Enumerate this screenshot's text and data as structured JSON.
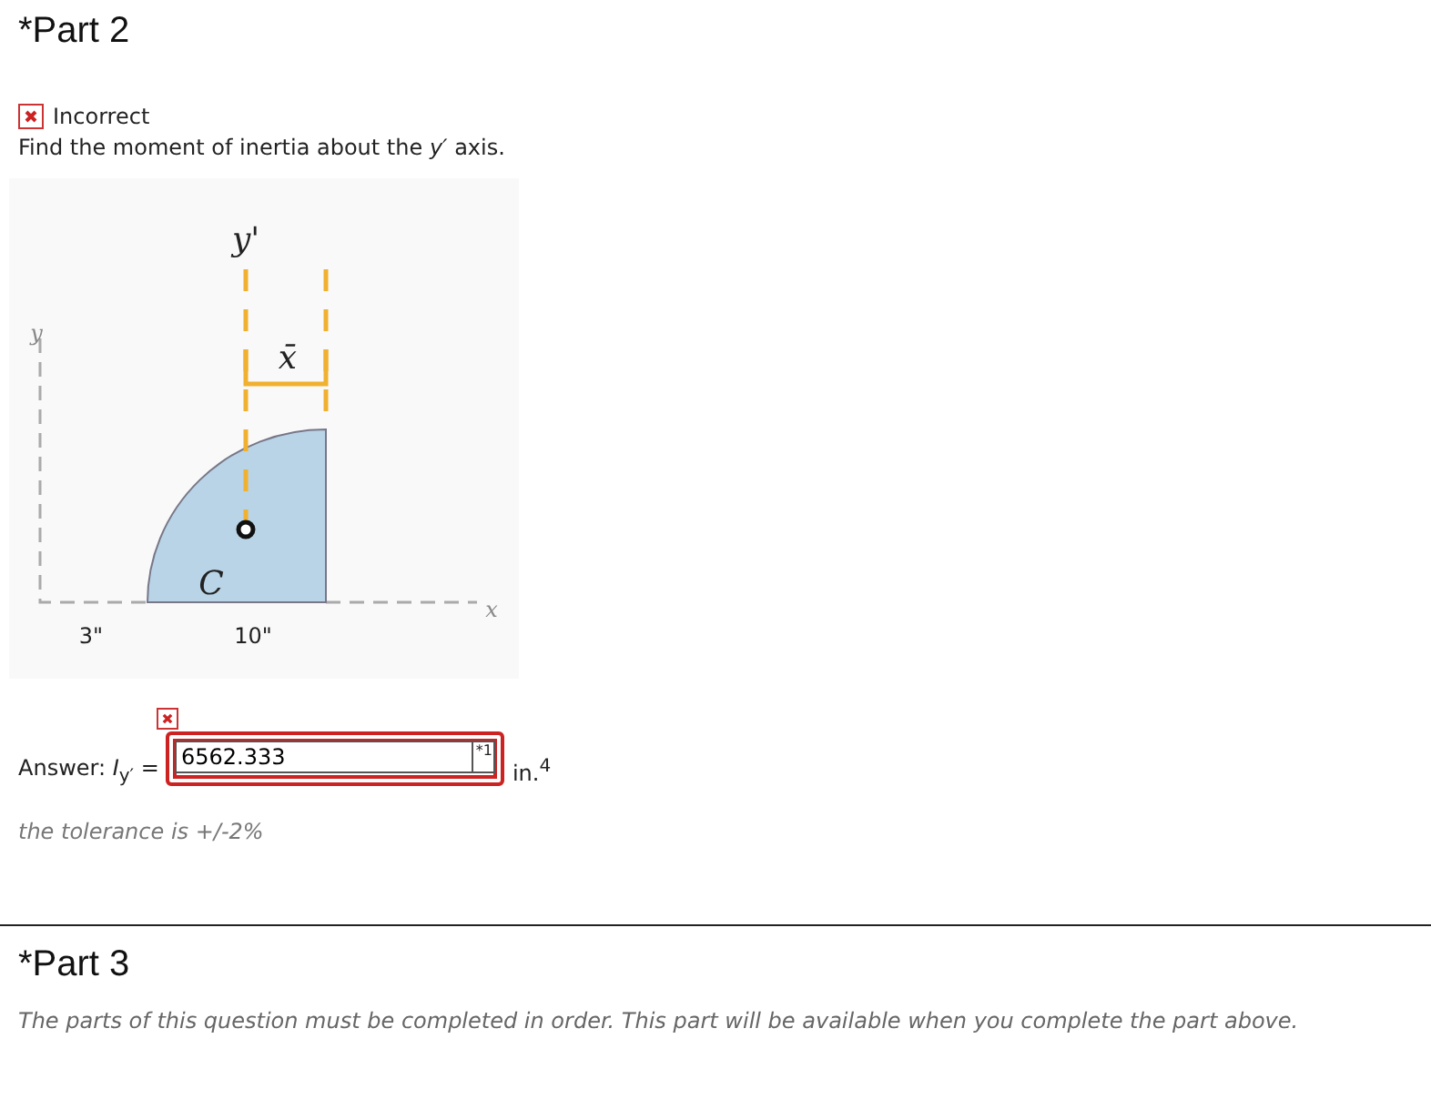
{
  "part2": {
    "title": "*Part 2",
    "status": {
      "kind": "incorrect",
      "label": "Incorrect"
    },
    "question": "Find the moment of inertia about the *y′* axis.",
    "figure": {
      "labels": [
        "y'",
        "x̄",
        "y",
        "C",
        "x",
        "3\"",
        "10\""
      ]
    },
    "answer": {
      "label": "Answer: *I*$_{y′}$ =",
      "value": "6562.333",
      "marker": "*1",
      "unit": "in.$^{4}$",
      "incorrect": true,
      "tolerance": "the tolerance is +/-2%"
    }
  },
  "part3": {
    "title": "*Part 3",
    "note": "The parts of this question must be completed in order. This part will be available when you complete the part above."
  }
}
